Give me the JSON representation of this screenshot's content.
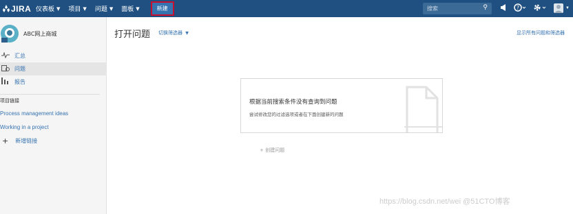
{
  "header": {
    "logo_text": "JIRA",
    "nav": [
      {
        "label": "仪表板"
      },
      {
        "label": "项目"
      },
      {
        "label": "问题"
      },
      {
        "label": "面板"
      }
    ],
    "create_label": "新建",
    "search_placeholder": "搜索"
  },
  "sidebar": {
    "project_name": "ABC网上商城",
    "items": [
      {
        "label": "汇总",
        "icon": "activity-icon"
      },
      {
        "label": "问题",
        "icon": "issues-icon",
        "active": true
      },
      {
        "label": "报告",
        "icon": "reports-icon"
      }
    ],
    "links_heading": "项目链接",
    "links": [
      {
        "label": "Process management ideas"
      },
      {
        "label": "Working in a project"
      }
    ],
    "add_link_label": "新增链接"
  },
  "main": {
    "title": "打开问题",
    "switch_filter": "切换筛选器",
    "show_all": "显示所有问题和筛选器",
    "empty_title": "根据当前搜索条件没有查询到问题",
    "empty_sub": "尝试修改您的过滤选项或者在下面创建新的问题",
    "create_issue": "+ 创建问题"
  },
  "watermark": "https://blog.csdn.net/wei @51CTO博客",
  "colors": {
    "topbar": "#205081",
    "link": "#3572b0",
    "highlight": "#c8102e"
  }
}
